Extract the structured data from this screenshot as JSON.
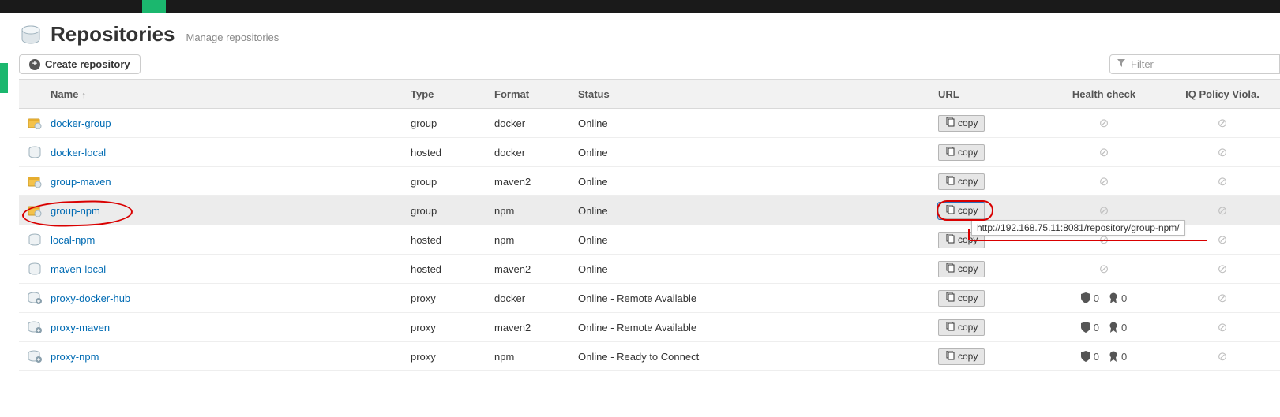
{
  "header": {
    "title": "Repositories",
    "subtitle": "Manage repositories"
  },
  "toolbar": {
    "create_label": "Create repository",
    "filter_placeholder": "Filter"
  },
  "table": {
    "columns": {
      "name": "Name",
      "type": "Type",
      "format": "Format",
      "status": "Status",
      "url": "URL",
      "health": "Health check",
      "iq": "IQ Policy Viola."
    },
    "copy_label": "copy",
    "rows": [
      {
        "icon": "group",
        "name": "docker-group",
        "type": "group",
        "format": "docker",
        "status": "Online",
        "health": "na",
        "iq": "na",
        "selected": false,
        "copy_active": false
      },
      {
        "icon": "hosted",
        "name": "docker-local",
        "type": "hosted",
        "format": "docker",
        "status": "Online",
        "health": "na",
        "iq": "na",
        "selected": false,
        "copy_active": false
      },
      {
        "icon": "group",
        "name": "group-maven",
        "type": "group",
        "format": "maven2",
        "status": "Online",
        "health": "na",
        "iq": "na",
        "selected": false,
        "copy_active": false
      },
      {
        "icon": "group",
        "name": "group-npm",
        "type": "group",
        "format": "npm",
        "status": "Online",
        "health": "na",
        "iq": "na",
        "selected": true,
        "copy_active": true,
        "tooltip": "http://192.168.75.11:8081/repository/group-npm/"
      },
      {
        "icon": "hosted",
        "name": "local-npm",
        "type": "hosted",
        "format": "npm",
        "status": "Online",
        "health": "na",
        "iq": "na",
        "selected": false,
        "copy_active": false
      },
      {
        "icon": "hosted",
        "name": "maven-local",
        "type": "hosted",
        "format": "maven2",
        "status": "Online",
        "health": "na",
        "iq": "na",
        "selected": false,
        "copy_active": false
      },
      {
        "icon": "proxy",
        "name": "proxy-docker-hub",
        "type": "proxy",
        "format": "docker",
        "status": "Online - Remote Available",
        "health": "counts",
        "shield": 0,
        "ribbon": 0,
        "iq": "na",
        "selected": false,
        "copy_active": false
      },
      {
        "icon": "proxy",
        "name": "proxy-maven",
        "type": "proxy",
        "format": "maven2",
        "status": "Online - Remote Available",
        "health": "counts",
        "shield": 0,
        "ribbon": 0,
        "iq": "na",
        "selected": false,
        "copy_active": false
      },
      {
        "icon": "proxy",
        "name": "proxy-npm",
        "type": "proxy",
        "format": "npm",
        "status": "Online - Ready to Connect",
        "health": "counts",
        "shield": 0,
        "ribbon": 0,
        "iq": "na",
        "selected": false,
        "copy_active": false
      }
    ]
  }
}
